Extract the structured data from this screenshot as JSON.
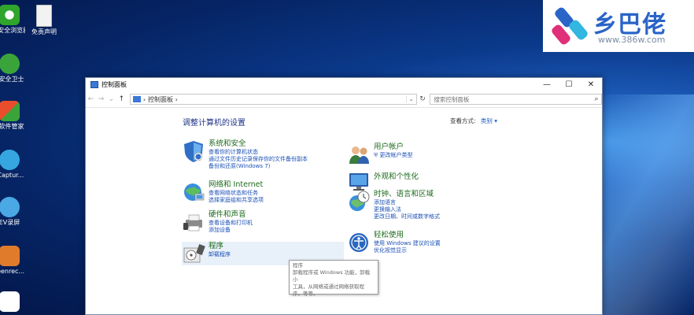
{
  "desktop": {
    "icons": [
      {
        "label": "0安全浏览器",
        "color": "#2fa52b"
      },
      {
        "label": "免责声明",
        "color": "#e9e9e9"
      },
      {
        "label": "0安全卫士",
        "color": "#3aa43a"
      },
      {
        "label": "0软件管家",
        "color": "#e94d2c"
      },
      {
        "label": "/Captur...",
        "color": "#35a6e0"
      },
      {
        "label": "EV录屏",
        "color": "#4aa8e4"
      },
      {
        "label": "reenrec...",
        "color": "#e07b2c"
      }
    ]
  },
  "watermark": {
    "name": "乡巴佬",
    "url": "www.386w.com"
  },
  "window": {
    "title": "控制面板",
    "controls": {
      "minimize": "—",
      "maximize": "☐",
      "close": "✕"
    },
    "nav": {
      "back": "←",
      "forward": "→",
      "recent": "⌄",
      "up": "↑"
    },
    "address": {
      "crumb": "控制面板",
      "separator": "›",
      "dropdown": "⌄",
      "refresh": "↻"
    },
    "search": {
      "placeholder": "搜索控制面板",
      "icon": "⌕"
    },
    "heading": "调整计算机的设置",
    "view_by": {
      "label": "查看方式:",
      "value": "类别 ▾"
    },
    "left_categories": [
      {
        "title": "系统和安全",
        "links": [
          "查看你的计算机状态",
          "通过文件历史记录保存你的文件备份副本",
          "备份和还原(Windows 7)"
        ]
      },
      {
        "title": "网络和 Internet",
        "links": [
          "查看网络状态和任务",
          "选择家庭组和共享选项"
        ]
      },
      {
        "title": "硬件和声音",
        "links": [
          "查看设备和打印机",
          "添加设备"
        ]
      },
      {
        "title": "程序",
        "links": [
          "卸载程序"
        ]
      }
    ],
    "right_categories": [
      {
        "title": "用户帐户",
        "links": [
          "更改帐户类型"
        ]
      },
      {
        "title": "外观和个性化",
        "links": []
      },
      {
        "title": "时钟、语言和区域",
        "links": [
          "添加语言",
          "更换输入法",
          "更改日期、时间或数字格式"
        ]
      },
      {
        "title": "轻松使用",
        "links": [
          "使用 Windows 建议的设置",
          "优化视觉显示"
        ]
      }
    ],
    "tooltip": {
      "lines": [
        "程序",
        "卸载程序或 Windows 功能，卸载小",
        "工具，从网络或通过网络获取程",
        "序。等等。"
      ]
    }
  }
}
